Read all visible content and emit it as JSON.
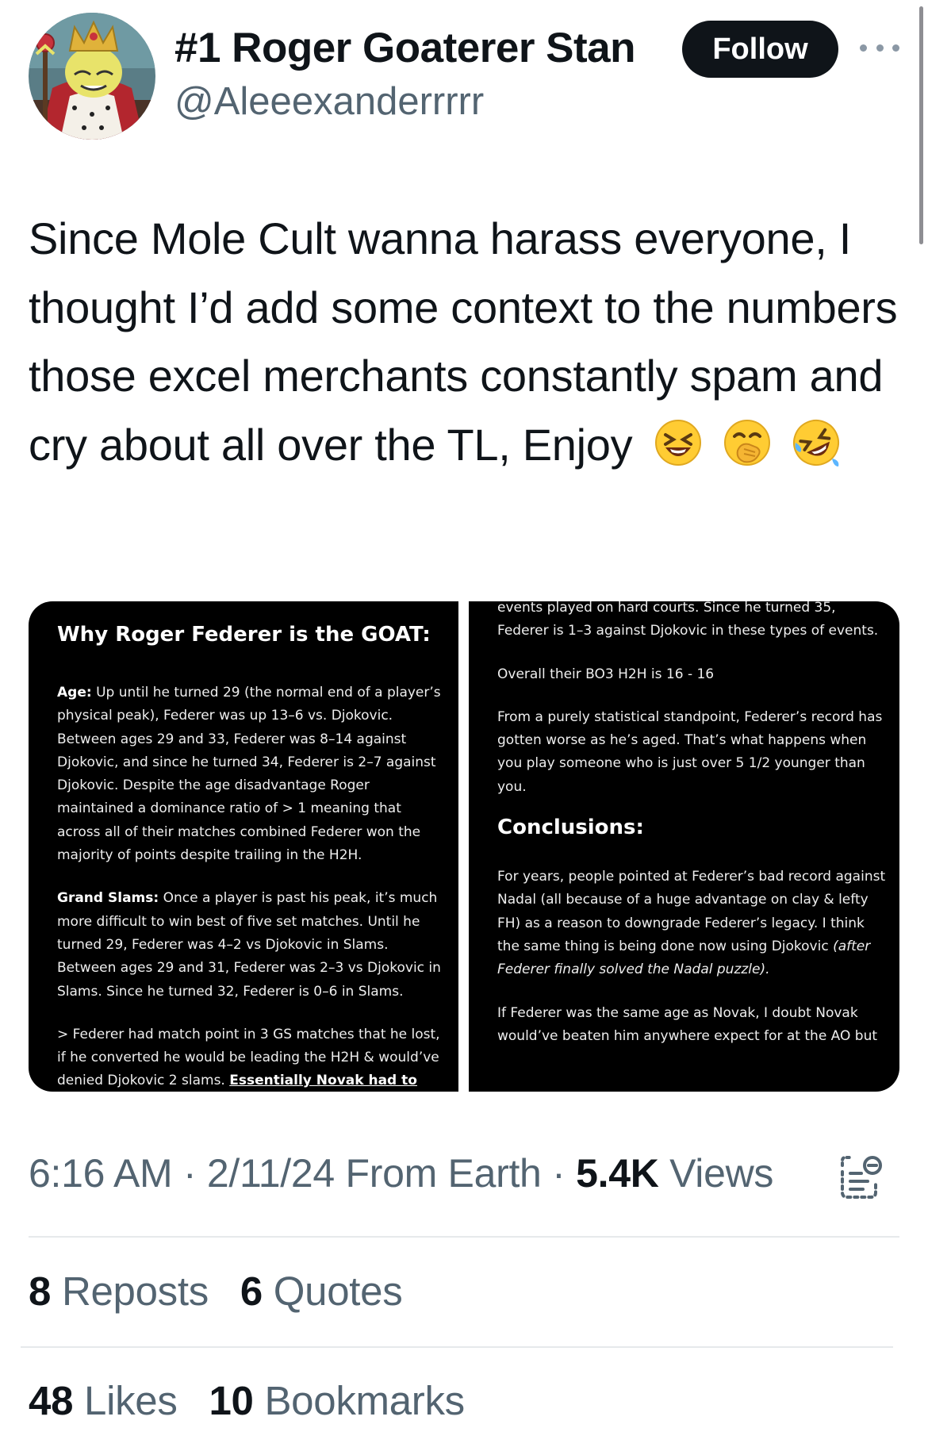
{
  "author": {
    "display_name": "#1 Roger Goaterer Stan",
    "handle": "@Aleeexanderrrrr",
    "avatar_icon": "spongebob-king-avatar"
  },
  "actions": {
    "follow_label": "Follow",
    "more_icon": "more-dots-icon"
  },
  "tweet": {
    "text": "Since Mole Cult wanna harass everyone, I thought I’d add some context to the numbers those excel merchants constantly spam and cry about all over the TL, Enjoy",
    "emojis": [
      "laughing-squint-emoji",
      "hand-over-mouth-emoji",
      "rolling-laughing-emoji"
    ]
  },
  "media": {
    "left": {
      "title": "Why Roger Federer is the GOAT:",
      "age_label": "Age:",
      "age_text": "Up until he turned 29 (the normal end of a player’s physical peak), Federer was up 13–6 vs. Djokovic. Between ages 29 and 33, Federer was 8–14 against Djokovic, and since he turned 34, Federer is 2–7 against Djokovic. Despite the age disadvantage Roger maintained a dominance ratio of > 1 meaning that across all of their matches combined Federer won the majority of points despite trailing in the H2H.",
      "slams_label": "Grand Slams:",
      "slams_text": "Once a player is past his peak, it’s much more difficult to win best of five set matches. Until he turned 29, Federer was 4–2 vs Djokovic in Slams. Between ages 29 and 31, Federer was 2–3 vs Djokovic in Slams. Since he turned 32, Federer is 0–6 in Slams.",
      "mp_text": "> Federer had match point in 3 GS matches that he lost, if he converted he would be leading the H2H & would’ve denied Djokovic 2 slams.",
      "mp_underlined": "Essentially Novak had to rely"
    },
    "right": {
      "hard_text": "events played on hard courts. Since he turned 35, Federer is 1–3 against Djokovic in these types of events.",
      "bo3_text": "Overall their BO3 H2H is 16 - 16",
      "stat_text": "From a purely statistical standpoint, Federer’s record has gotten worse as he’s aged. That’s what happens when you play someone who is just over 5 1/2 younger than you.",
      "conclusions_title": "Conclusions:",
      "conclusions_text": "For years, people pointed at Federer’s bad record against Nadal (all because of a huge advantage on clay & lefty FH) as a reason to downgrade Federer’s legacy. I think the same thing is being done now using Djokovic",
      "conclusions_italic": "(after Federer finally solved the Nadal puzzle).",
      "final_text": "If Federer was the same age as Novak, I doubt Novak would’ve beaten him anywhere expect for at the AO but"
    }
  },
  "meta": {
    "time": "6:16 AM",
    "date": "2/11/24",
    "source": "From Earth",
    "views_count": "5.4K",
    "views_label": "Views",
    "analytics_icon": "analytics-icon"
  },
  "stats": {
    "reposts_count": "8",
    "reposts_label": "Reposts",
    "quotes_count": "6",
    "quotes_label": "Quotes",
    "likes_count": "48",
    "likes_label": "Likes",
    "bookmarks_count": "10",
    "bookmarks_label": "Bookmarks"
  }
}
